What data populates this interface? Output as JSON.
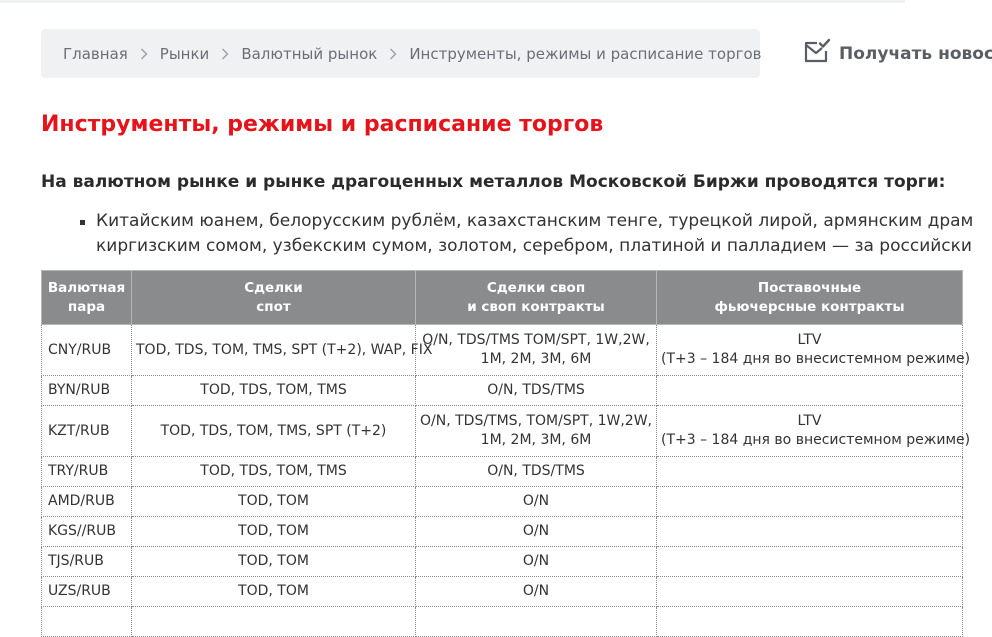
{
  "breadcrumb": {
    "items": [
      "Главная",
      "Рынки",
      "Валютный рынок",
      "Инструменты, режимы и расписание торгов"
    ]
  },
  "subscribe": {
    "label": "Получать новос",
    "icon": "mail-check-icon"
  },
  "page_title": "Инструменты, режимы и расписание торгов",
  "lead_text": "На валютном рынке и рынке драгоценных металлов Московской Биржи проводятся торги:",
  "bullet": {
    "line1": "Китайским юанем, белорусским рублём, казахстанским тенге, турецкой лирой, армянским драм",
    "line2": "киргизским сомом, узбекским сумом, золотом, серебром, платиной и палладием — за российски"
  },
  "table": {
    "headers": [
      {
        "line1": "Валютная",
        "line2": "пара"
      },
      {
        "line1": "Сделки",
        "line2": "спот"
      },
      {
        "line1": "Сделки своп",
        "line2": "и своп контракты"
      },
      {
        "line1": "Поставочные",
        "line2": "фьючерсные контракты"
      }
    ],
    "rows": [
      {
        "pair": "CNY/RUB",
        "spot": "TOD, TDS, TOM, TMS, SPT (T+2), WAP, FIX",
        "swap1": "O/N, TDS/TMS TOM/SPT, 1W,2W,",
        "swap2": "1M, 2M, 3M, 6M",
        "fut1": "LTV",
        "fut2": "(T+3 – 184 дня во внесистемном режиме)"
      },
      {
        "pair": "BYN/RUB",
        "spot": "TOD, TDS, TOM, TMS",
        "swap1": "O/N, TDS/TMS",
        "swap2": "",
        "fut1": "",
        "fut2": ""
      },
      {
        "pair": "KZT/RUB",
        "spot": "TOD, TDS, TOM, TMS, SPT (T+2)",
        "swap1": "O/N, TDS/TMS, TOM/SPT, 1W,2W,",
        "swap2": "1M, 2M, 3M, 6M",
        "fut1": "LTV",
        "fut2": "(T+3 – 184 дня во внесистемном режиме)"
      },
      {
        "pair": "TRY/RUB",
        "spot": "TOD, TDS, TOM, TMS",
        "swap1": "O/N, TDS/TMS",
        "swap2": "",
        "fut1": "",
        "fut2": ""
      },
      {
        "pair": "AMD/RUB",
        "spot": "TOD, TOM",
        "swap1": "O/N",
        "swap2": "",
        "fut1": "",
        "fut2": ""
      },
      {
        "pair": "KGS//RUB",
        "spot": "TOD, TOM",
        "swap1": "O/N",
        "swap2": "",
        "fut1": "",
        "fut2": ""
      },
      {
        "pair": "TJS/RUB",
        "spot": "TOD, TOM",
        "swap1": "O/N",
        "swap2": "",
        "fut1": "",
        "fut2": ""
      },
      {
        "pair": "UZS/RUB",
        "spot": "TOD, TOM",
        "swap1": "O/N",
        "swap2": "",
        "fut1": "",
        "fut2": ""
      }
    ]
  },
  "colors": {
    "title_red": "#e5131a",
    "header_gray": "#8a8b8d",
    "breadcrumb_bg": "#f0f1f3"
  }
}
